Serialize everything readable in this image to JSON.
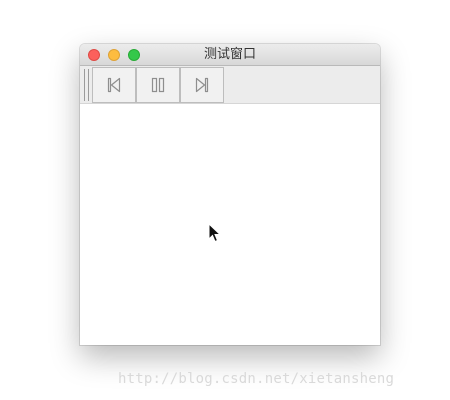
{
  "window": {
    "title": "测试窗口"
  },
  "toolbar": {
    "buttons": [
      {
        "icon": "skip-previous-icon"
      },
      {
        "icon": "pause-icon"
      },
      {
        "icon": "skip-next-icon"
      }
    ]
  },
  "watermark": {
    "text": "http://blog.csdn.net/xietansheng"
  },
  "colors": {
    "close": "#fc605c",
    "minimize": "#fdbc40",
    "maximize": "#34c84a",
    "icon_stroke": "#8e8e8e"
  }
}
